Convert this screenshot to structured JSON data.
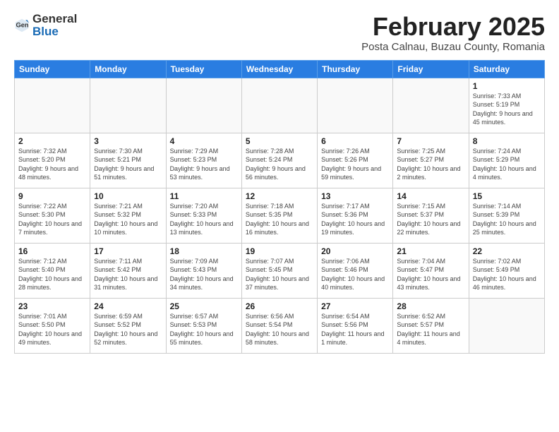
{
  "app": {
    "logo_general": "General",
    "logo_blue": "Blue"
  },
  "header": {
    "title": "February 2025",
    "subtitle": "Posta Calnau, Buzau County, Romania"
  },
  "weekdays": [
    "Sunday",
    "Monday",
    "Tuesday",
    "Wednesday",
    "Thursday",
    "Friday",
    "Saturday"
  ],
  "weeks": [
    [
      {
        "day": "",
        "info": ""
      },
      {
        "day": "",
        "info": ""
      },
      {
        "day": "",
        "info": ""
      },
      {
        "day": "",
        "info": ""
      },
      {
        "day": "",
        "info": ""
      },
      {
        "day": "",
        "info": ""
      },
      {
        "day": "1",
        "info": "Sunrise: 7:33 AM\nSunset: 5:19 PM\nDaylight: 9 hours and 45 minutes."
      }
    ],
    [
      {
        "day": "2",
        "info": "Sunrise: 7:32 AM\nSunset: 5:20 PM\nDaylight: 9 hours and 48 minutes."
      },
      {
        "day": "3",
        "info": "Sunrise: 7:30 AM\nSunset: 5:21 PM\nDaylight: 9 hours and 51 minutes."
      },
      {
        "day": "4",
        "info": "Sunrise: 7:29 AM\nSunset: 5:23 PM\nDaylight: 9 hours and 53 minutes."
      },
      {
        "day": "5",
        "info": "Sunrise: 7:28 AM\nSunset: 5:24 PM\nDaylight: 9 hours and 56 minutes."
      },
      {
        "day": "6",
        "info": "Sunrise: 7:26 AM\nSunset: 5:26 PM\nDaylight: 9 hours and 59 minutes."
      },
      {
        "day": "7",
        "info": "Sunrise: 7:25 AM\nSunset: 5:27 PM\nDaylight: 10 hours and 2 minutes."
      },
      {
        "day": "8",
        "info": "Sunrise: 7:24 AM\nSunset: 5:29 PM\nDaylight: 10 hours and 4 minutes."
      }
    ],
    [
      {
        "day": "9",
        "info": "Sunrise: 7:22 AM\nSunset: 5:30 PM\nDaylight: 10 hours and 7 minutes."
      },
      {
        "day": "10",
        "info": "Sunrise: 7:21 AM\nSunset: 5:32 PM\nDaylight: 10 hours and 10 minutes."
      },
      {
        "day": "11",
        "info": "Sunrise: 7:20 AM\nSunset: 5:33 PM\nDaylight: 10 hours and 13 minutes."
      },
      {
        "day": "12",
        "info": "Sunrise: 7:18 AM\nSunset: 5:35 PM\nDaylight: 10 hours and 16 minutes."
      },
      {
        "day": "13",
        "info": "Sunrise: 7:17 AM\nSunset: 5:36 PM\nDaylight: 10 hours and 19 minutes."
      },
      {
        "day": "14",
        "info": "Sunrise: 7:15 AM\nSunset: 5:37 PM\nDaylight: 10 hours and 22 minutes."
      },
      {
        "day": "15",
        "info": "Sunrise: 7:14 AM\nSunset: 5:39 PM\nDaylight: 10 hours and 25 minutes."
      }
    ],
    [
      {
        "day": "16",
        "info": "Sunrise: 7:12 AM\nSunset: 5:40 PM\nDaylight: 10 hours and 28 minutes."
      },
      {
        "day": "17",
        "info": "Sunrise: 7:11 AM\nSunset: 5:42 PM\nDaylight: 10 hours and 31 minutes."
      },
      {
        "day": "18",
        "info": "Sunrise: 7:09 AM\nSunset: 5:43 PM\nDaylight: 10 hours and 34 minutes."
      },
      {
        "day": "19",
        "info": "Sunrise: 7:07 AM\nSunset: 5:45 PM\nDaylight: 10 hours and 37 minutes."
      },
      {
        "day": "20",
        "info": "Sunrise: 7:06 AM\nSunset: 5:46 PM\nDaylight: 10 hours and 40 minutes."
      },
      {
        "day": "21",
        "info": "Sunrise: 7:04 AM\nSunset: 5:47 PM\nDaylight: 10 hours and 43 minutes."
      },
      {
        "day": "22",
        "info": "Sunrise: 7:02 AM\nSunset: 5:49 PM\nDaylight: 10 hours and 46 minutes."
      }
    ],
    [
      {
        "day": "23",
        "info": "Sunrise: 7:01 AM\nSunset: 5:50 PM\nDaylight: 10 hours and 49 minutes."
      },
      {
        "day": "24",
        "info": "Sunrise: 6:59 AM\nSunset: 5:52 PM\nDaylight: 10 hours and 52 minutes."
      },
      {
        "day": "25",
        "info": "Sunrise: 6:57 AM\nSunset: 5:53 PM\nDaylight: 10 hours and 55 minutes."
      },
      {
        "day": "26",
        "info": "Sunrise: 6:56 AM\nSunset: 5:54 PM\nDaylight: 10 hours and 58 minutes."
      },
      {
        "day": "27",
        "info": "Sunrise: 6:54 AM\nSunset: 5:56 PM\nDaylight: 11 hours and 1 minute."
      },
      {
        "day": "28",
        "info": "Sunrise: 6:52 AM\nSunset: 5:57 PM\nDaylight: 11 hours and 4 minutes."
      },
      {
        "day": "",
        "info": ""
      }
    ]
  ]
}
